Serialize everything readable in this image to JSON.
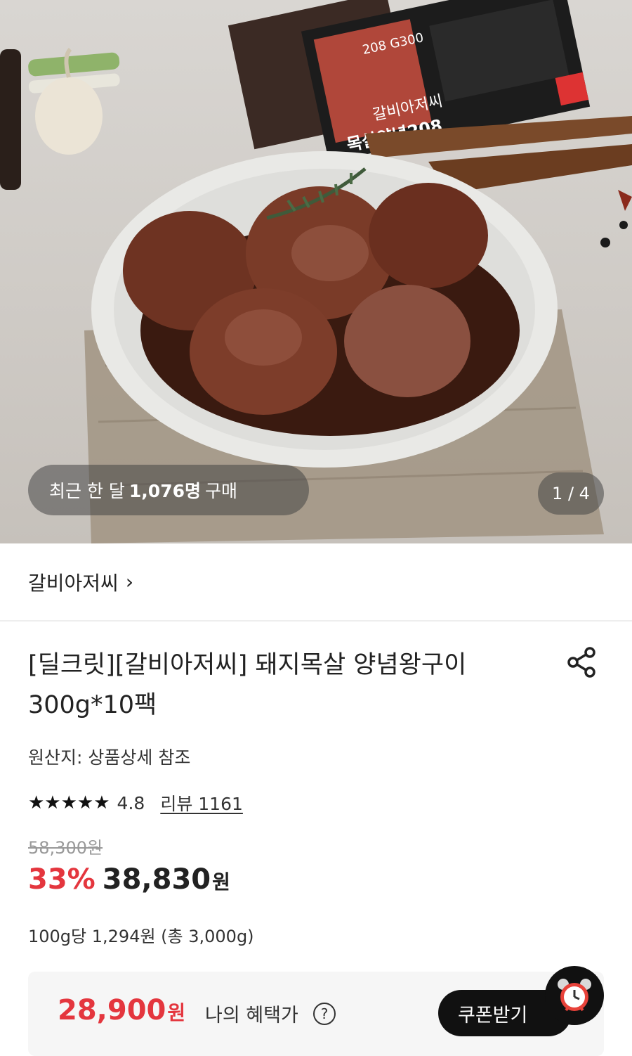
{
  "hero": {
    "package_text_1": "갈비아저씨",
    "package_text_2": "목살양념208",
    "package_text_3": "208 G300",
    "buyers_prefix": "최근 한 달",
    "buyers_count": "1,076명",
    "buyers_suffix": "구매",
    "image_counter": "1 / 4"
  },
  "brand": {
    "name": "갈비아저씨",
    "chevron": "›"
  },
  "product": {
    "title_line1": "[딜크릿][갈비아저씨] 돼지목살 양념왕구이",
    "title_line2": "300g*10팩",
    "origin": "원산지: 상품상세 참조",
    "stars": "★★★★★",
    "rating": "4.8",
    "review": "리뷰 1161",
    "original_price": "58,300원",
    "discount": "33%",
    "sale_price": "38,830",
    "sale_unit": "원",
    "unit_price": "100g당 1,294원 (총 3,000g)"
  },
  "benefit": {
    "amount": "28,900",
    "unit": "원",
    "label": "나의 혜택가",
    "help": "?",
    "coupon_button": "쿠폰받기"
  },
  "colors": {
    "accent_red": "#e4363e",
    "dark": "#111111"
  },
  "icons": [
    "share-icon",
    "chevron-right-icon",
    "star-icon",
    "help-icon",
    "alarm-clock-icon"
  ]
}
